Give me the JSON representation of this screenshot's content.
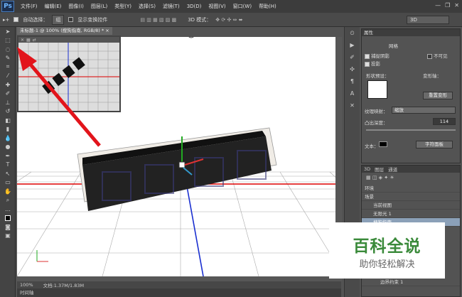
{
  "app": {
    "logo": "Ps"
  },
  "menu": [
    "文件(F)",
    "编辑(E)",
    "图像(I)",
    "图层(L)",
    "类型(Y)",
    "选择(S)",
    "滤镜(T)",
    "3D(D)",
    "视图(V)",
    "窗口(W)",
    "帮助(H)"
  ],
  "options": {
    "auto_select": "自动选择：",
    "auto_select_value": "组",
    "show_transform": "显示变换控件",
    "mode3d": "3D 模式：",
    "workspace": "3D"
  },
  "document": {
    "tab": "未标题-1 @ 100% (搜狗指南, RGB/8) *",
    "close": "×"
  },
  "status": {
    "zoom": "100%",
    "doc": "文档:1.37M/1.83M"
  },
  "timeline": "时间轴",
  "properties": {
    "title": "属性",
    "tab_label": "网格",
    "cast_shadow": "捕捉阴影",
    "invisible": "不可见",
    "cast": "投影",
    "shape_preset": "形状预设：",
    "deform_axis": "变形轴：",
    "reset_deform": "重置变形",
    "texture_map": "纹理映射：",
    "texture_value": "缩放",
    "extrude_depth": "凸出深度：",
    "extrude_value": "114",
    "text_label": "文本：",
    "char_panel": "字符面板"
  },
  "panel3d": {
    "tabs": [
      "3D",
      "图层",
      "通道"
    ],
    "rows": [
      "环境",
      "场景",
      "当前视图",
      "无限光 1",
      "搜狗指南",
      "边界约束 1"
    ]
  },
  "watermark": {
    "title": "百科全说",
    "subtitle": "助你轻松解决"
  }
}
